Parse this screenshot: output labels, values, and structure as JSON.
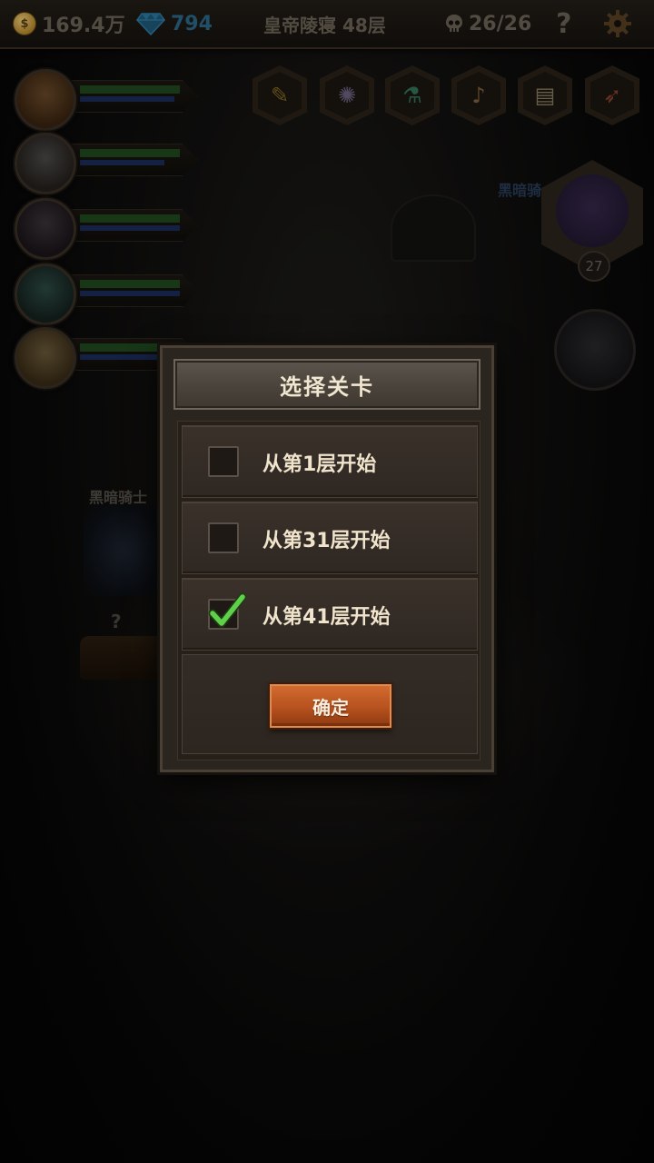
{
  "topbar": {
    "gold": "169.4万",
    "gold_icon_glyph": "$",
    "gems": "794",
    "stage_title": "皇帝陵寝 48层",
    "kills": "26/26",
    "help_label": "?",
    "icons": [
      "gold-coin-icon",
      "diamond-icon",
      "skull-icon",
      "help-icon",
      "gear-icon"
    ]
  },
  "heroes": [
    {
      "hp": 0.95,
      "mp": 0.9
    },
    {
      "hp": 0.95,
      "mp": 0.8
    },
    {
      "hp": 0.95,
      "mp": 0.95
    },
    {
      "hp": 0.95,
      "mp": 0.95
    },
    {
      "hp": 0.95,
      "mp": 0.95
    }
  ],
  "skills": [
    "feather-icon",
    "vortex-icon",
    "potion-icon",
    "bell-icon",
    "scroll-icon",
    "carrot-icon"
  ],
  "scene": {
    "boss_name": "黑暗骑",
    "boss_level": "27",
    "enemy_name": "黑暗骑士",
    "chest_hint": "?"
  },
  "dialog": {
    "title": "选择关卡",
    "options": [
      {
        "label": "从第1层开始",
        "checked": false
      },
      {
        "label": "从第31层开始",
        "checked": false
      },
      {
        "label": "从第41层开始",
        "checked": true
      }
    ],
    "confirm_label": "确定"
  },
  "colors": {
    "accent_button": "#b7511e",
    "check_green": "#5fd04a",
    "panel": "#2b2520"
  }
}
